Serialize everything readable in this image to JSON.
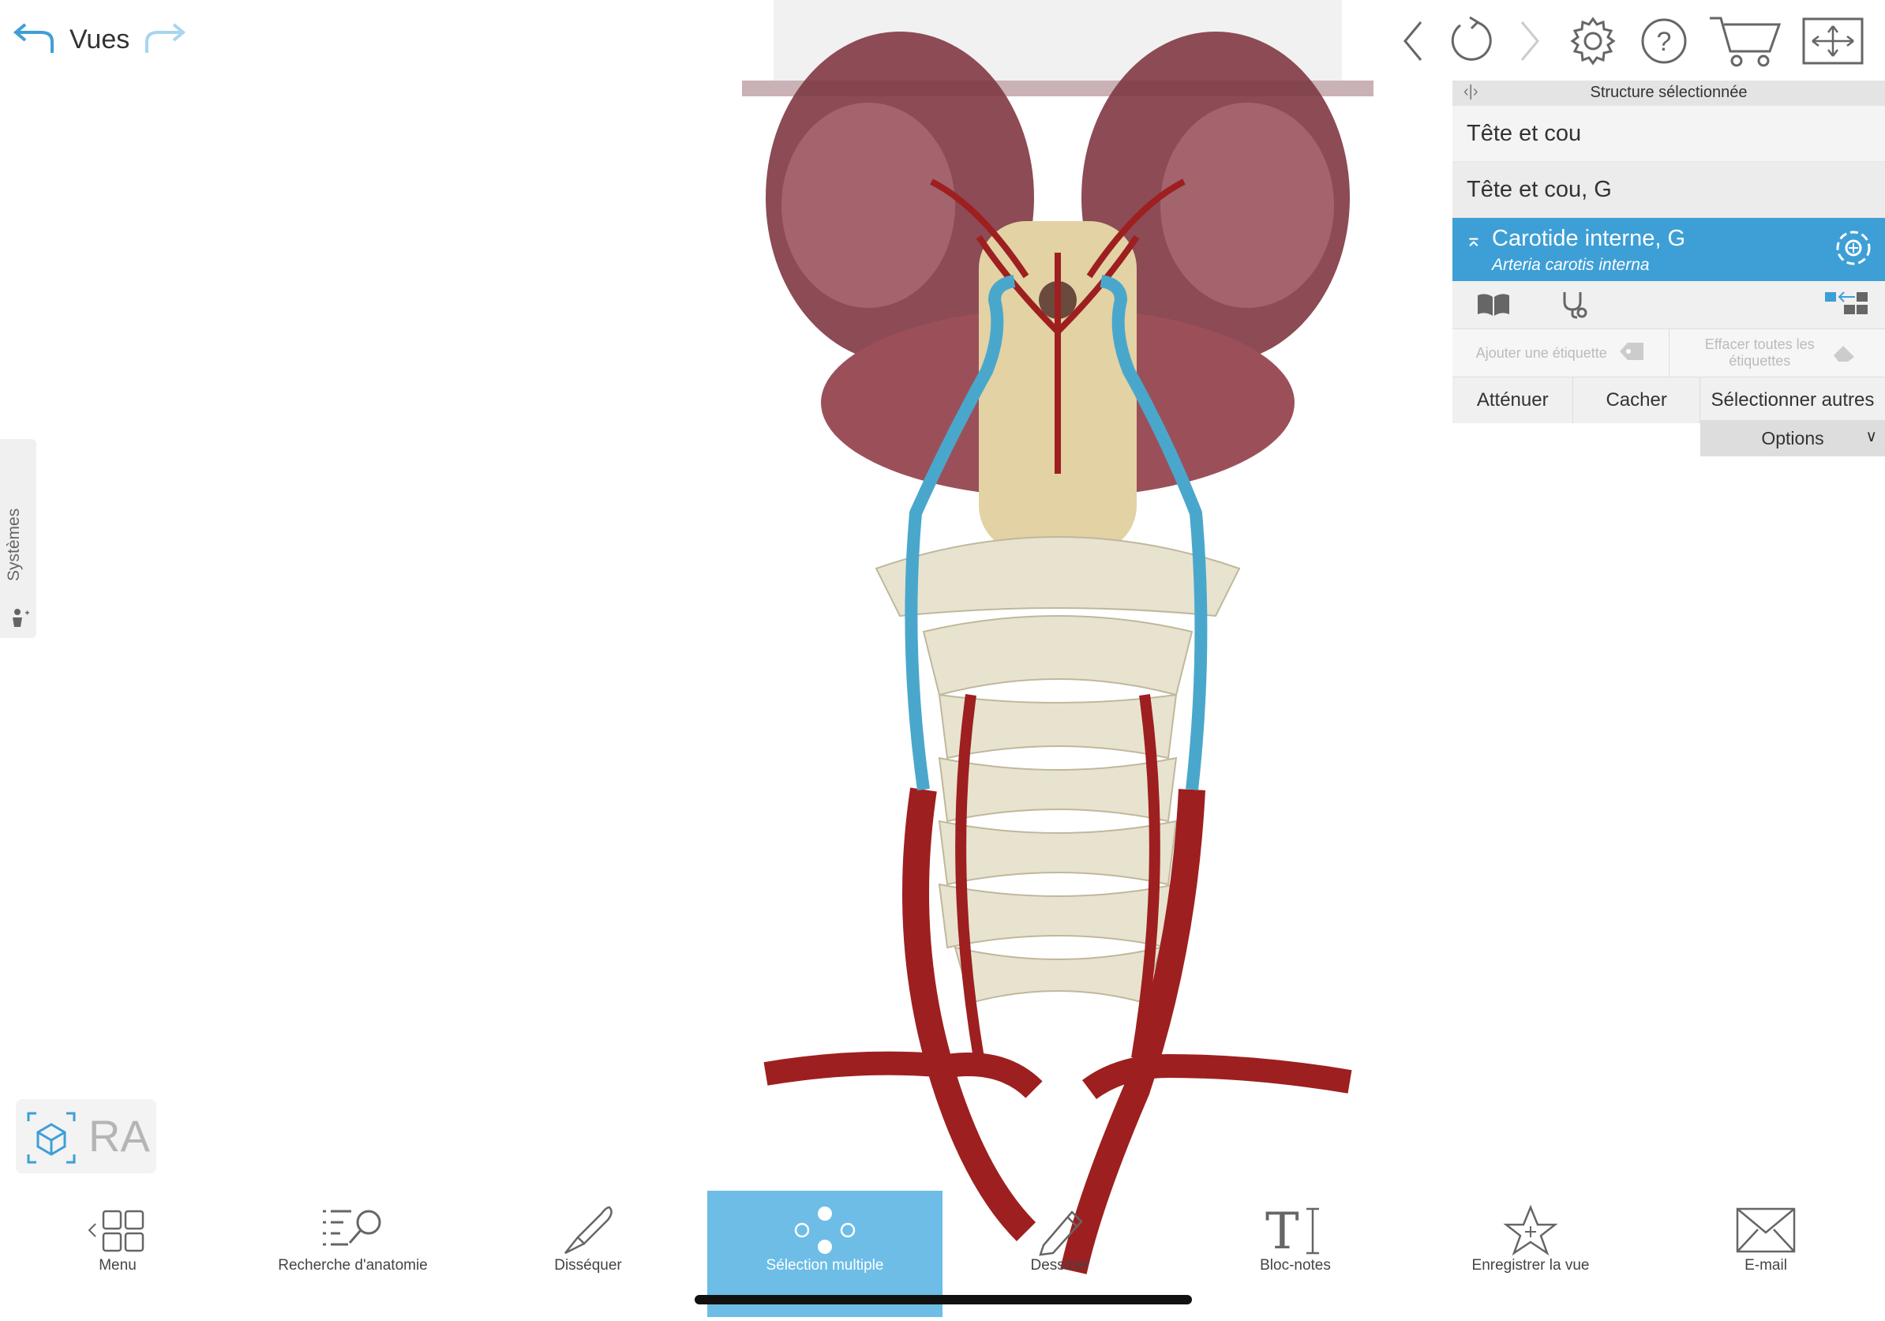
{
  "views": {
    "label": "Vues",
    "undo_icon": "undo-icon",
    "redo_icon": "redo-icon"
  },
  "toolbar": {
    "icons": [
      "back-icon",
      "reset-icon",
      "forward-icon",
      "settings-icon",
      "help-icon",
      "cart-icon",
      "fullscreen-icon"
    ]
  },
  "panel": {
    "header": "Structure sélectionnée",
    "crumbs": [
      "Tête et cou",
      "Tête et cou, G"
    ],
    "selected": {
      "name": "Carotide interne, G",
      "latin": "Arteria carotis interna"
    },
    "add_label": "Ajouter une étiquette",
    "clear_labels": "Effacer toutes les étiquettes",
    "actions": [
      "Atténuer",
      "Cacher",
      "Sélectionner autres"
    ],
    "options": "Options"
  },
  "systems": {
    "label": "Systèmes"
  },
  "ar": {
    "label": "RA"
  },
  "bottom": {
    "items": [
      {
        "label": "Menu",
        "icon": "menu-grid-icon"
      },
      {
        "label": "Recherche d'anatomie",
        "icon": "anatomy-search-icon"
      },
      {
        "label": "Disséquer",
        "icon": "scalpel-icon"
      },
      {
        "label": "Sélection multiple",
        "icon": "multi-select-icon",
        "active": true
      },
      {
        "label": "Dessiner",
        "icon": "pencil-icon"
      },
      {
        "label": "Bloc-notes",
        "icon": "notepad-icon"
      },
      {
        "label": "Enregistrer la vue",
        "icon": "save-view-icon"
      },
      {
        "label": "E-mail",
        "icon": "email-icon"
      }
    ]
  },
  "colors": {
    "accent": "#3e9fd6",
    "active_tab": "#6dbde6",
    "artery": "#9e1f1f",
    "highlight": "#4aa7cc"
  }
}
